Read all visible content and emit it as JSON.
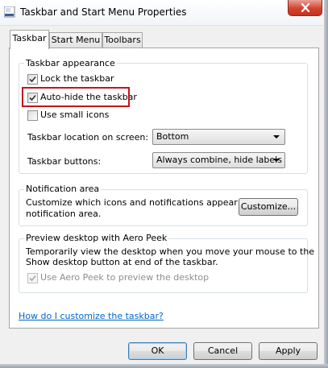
{
  "window": {
    "title": "Taskbar and Start Menu Properties"
  },
  "tabs": [
    {
      "label": "Taskbar",
      "active": true
    },
    {
      "label": "Start Menu",
      "active": false
    },
    {
      "label": "Toolbars",
      "active": false
    }
  ],
  "taskbar_appearance": {
    "title": "Taskbar appearance",
    "lock_taskbar": {
      "label": "Lock the taskbar",
      "checked": true
    },
    "auto_hide": {
      "label": "Auto-hide the taskbar",
      "checked": true,
      "highlighted": true
    },
    "small_icons": {
      "label": "Use small icons",
      "checked": false
    },
    "location": {
      "label": "Taskbar location on screen:",
      "value": "Bottom"
    },
    "buttons": {
      "label": "Taskbar buttons:",
      "value": "Always combine, hide labels"
    }
  },
  "notification_area": {
    "title": "Notification area",
    "description": [
      "Customize which icons and notifications appear in the",
      "notification area."
    ],
    "customize_label": "Customize..."
  },
  "aero_peek": {
    "title": "Preview desktop with Aero Peek",
    "description": [
      "Temporarily view the desktop when you move your mouse to the",
      "Show desktop button at end of the taskbar."
    ],
    "use_peek": {
      "label": "Use Aero Peek to preview the desktop",
      "checked": true,
      "disabled": true
    }
  },
  "help_link": "How do I customize the taskbar?",
  "buttons": {
    "ok": "OK",
    "cancel": "Cancel",
    "apply": "Apply"
  },
  "colors": {
    "highlight_border": "#c4141d",
    "link": "#0066cc",
    "close_button": "#d2452f"
  },
  "icons": {
    "title": "taskbar-properties-icon",
    "close": "close-icon",
    "check": "checkmark-icon",
    "dropdown": "chevron-down-icon"
  }
}
